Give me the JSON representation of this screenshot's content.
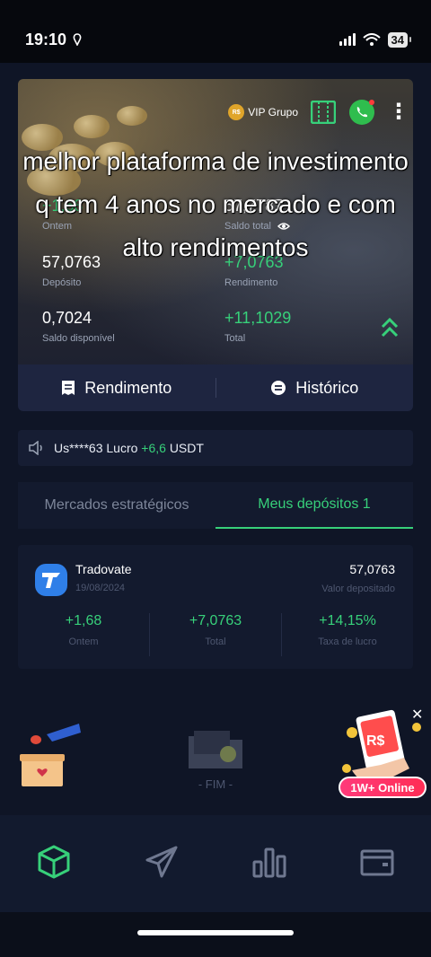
{
  "status_bar": {
    "time": "19:10",
    "battery": "34"
  },
  "header": {
    "vip_label": "VIP Grupo",
    "vip_coin": "R$"
  },
  "stats": {
    "yesterday": {
      "value": "+1,68",
      "label": "Ontem"
    },
    "total_balance": {
      "value": "57,7787",
      "label": "Saldo total"
    },
    "deposits": {
      "value": "57,0763",
      "label": "Depósito"
    },
    "income": {
      "value": "+7,0763",
      "label": "Rendimento"
    },
    "available": {
      "value": "0,7024",
      "label": "Saldo disponível"
    },
    "total": {
      "value": "+11,1029",
      "label": "Total"
    }
  },
  "caption": "melhor plataforma de investimento q tem 4 anos no mercado e com alto rendimentos",
  "actions": {
    "income_label": "Rendimento",
    "history_label": "Histórico"
  },
  "ticker": {
    "user": "Us****63 Lucro",
    "amount": "+6,6",
    "currency": "USDT"
  },
  "tabs": [
    {
      "label": "Mercados estratégicos",
      "active": false
    },
    {
      "label": "Meus depósitos 1",
      "active": true
    }
  ],
  "deposit": {
    "name": "Tradovate",
    "date": "19/08/2024",
    "value": "57,0763",
    "value_label": "Valor depositado",
    "metrics": [
      {
        "value": "+1,68",
        "label": "Ontem"
      },
      {
        "value": "+7,0763",
        "label": "Total"
      },
      {
        "value": "+14,15%",
        "label": "Taxa de lucro"
      }
    ]
  },
  "end_label": "- FIM -",
  "promo": {
    "coin": "R$",
    "badge": "1W+ Online"
  },
  "colors": {
    "accent": "#37d07a",
    "background": "#0f1526",
    "card": "#131a2e"
  }
}
